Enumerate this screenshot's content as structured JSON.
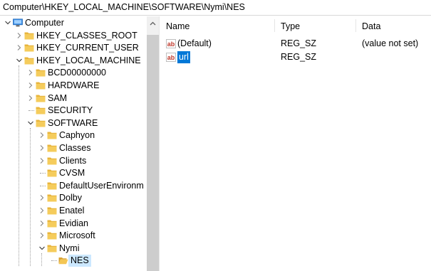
{
  "address_bar": {
    "path": "Computer\\HKEY_LOCAL_MACHINE\\SOFTWARE\\Nymi\\NES"
  },
  "tree": [
    {
      "label": "Computer",
      "level": 0,
      "expanded": true,
      "icon": "computer-icon",
      "has_children": true
    },
    {
      "label": "HKEY_CLASSES_ROOT",
      "level": 1,
      "expanded": false,
      "icon": "folder-icon",
      "has_children": true
    },
    {
      "label": "HKEY_CURRENT_USER",
      "level": 1,
      "expanded": false,
      "icon": "folder-icon",
      "has_children": true
    },
    {
      "label": "HKEY_LOCAL_MACHINE",
      "level": 1,
      "expanded": true,
      "icon": "folder-icon",
      "has_children": true
    },
    {
      "label": "BCD00000000",
      "level": 2,
      "expanded": false,
      "icon": "folder-icon",
      "has_children": true
    },
    {
      "label": "HARDWARE",
      "level": 2,
      "expanded": false,
      "icon": "folder-icon",
      "has_children": true
    },
    {
      "label": "SAM",
      "level": 2,
      "expanded": false,
      "icon": "folder-icon",
      "has_children": true
    },
    {
      "label": "SECURITY",
      "level": 2,
      "expanded": false,
      "icon": "folder-icon",
      "has_children": false
    },
    {
      "label": "SOFTWARE",
      "level": 2,
      "expanded": true,
      "icon": "folder-icon",
      "has_children": true
    },
    {
      "label": "Caphyon",
      "level": 3,
      "expanded": false,
      "icon": "folder-icon",
      "has_children": true
    },
    {
      "label": "Classes",
      "level": 3,
      "expanded": false,
      "icon": "folder-icon",
      "has_children": true
    },
    {
      "label": "Clients",
      "level": 3,
      "expanded": false,
      "icon": "folder-icon",
      "has_children": true
    },
    {
      "label": "CVSM",
      "level": 3,
      "expanded": false,
      "icon": "folder-icon",
      "has_children": false
    },
    {
      "label": "DefaultUserEnvironm",
      "level": 3,
      "expanded": false,
      "icon": "folder-icon",
      "has_children": false
    },
    {
      "label": "Dolby",
      "level": 3,
      "expanded": false,
      "icon": "folder-icon",
      "has_children": true
    },
    {
      "label": "Enatel",
      "level": 3,
      "expanded": false,
      "icon": "folder-icon",
      "has_children": true
    },
    {
      "label": "Evidian",
      "level": 3,
      "expanded": false,
      "icon": "folder-icon",
      "has_children": true
    },
    {
      "label": "Microsoft",
      "level": 3,
      "expanded": false,
      "icon": "folder-icon",
      "has_children": true
    },
    {
      "label": "Nymi",
      "level": 3,
      "expanded": true,
      "icon": "folder-icon",
      "has_children": true
    },
    {
      "label": "NES",
      "level": 4,
      "expanded": false,
      "icon": "folder-open-icon",
      "has_children": false,
      "selected": true
    }
  ],
  "columns": {
    "name": "Name",
    "type": "Type",
    "data": "Data"
  },
  "values": [
    {
      "name": "(Default)",
      "type": "REG_SZ",
      "data": "(value not set)",
      "icon": "string-value-icon"
    },
    {
      "name": "url",
      "type": "REG_SZ",
      "data": "",
      "icon": "string-value-icon",
      "selected": true
    }
  ],
  "colors": {
    "selection": "#0078d7",
    "folder": "#e8b53c",
    "tree_selected": "#cce8ff"
  }
}
